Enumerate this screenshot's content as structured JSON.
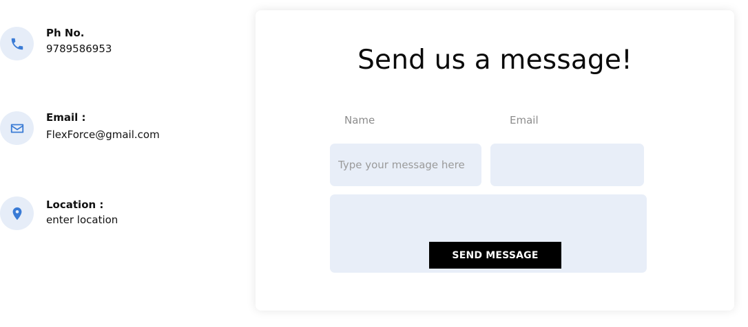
{
  "contacts": {
    "phone": {
      "label": "Ph No.",
      "value": "9789586953",
      "icon": "phone-icon"
    },
    "email": {
      "label": "Email :",
      "value": "FlexForce@gmail.com",
      "icon": "mail-icon"
    },
    "location": {
      "label": "Location :",
      "value": "enter location",
      "icon": "location-pin-icon"
    }
  },
  "form": {
    "title": "Send us a message!",
    "name_label": "Name",
    "email_label": "Email",
    "message_placeholder": "Type your message here",
    "submit_label": "SEND MESSAGE"
  },
  "colors": {
    "icon_accent": "#3a7bd5",
    "icon_bg": "#e6edf8",
    "field_bg": "#e8eef8",
    "button_bg": "#000000"
  }
}
